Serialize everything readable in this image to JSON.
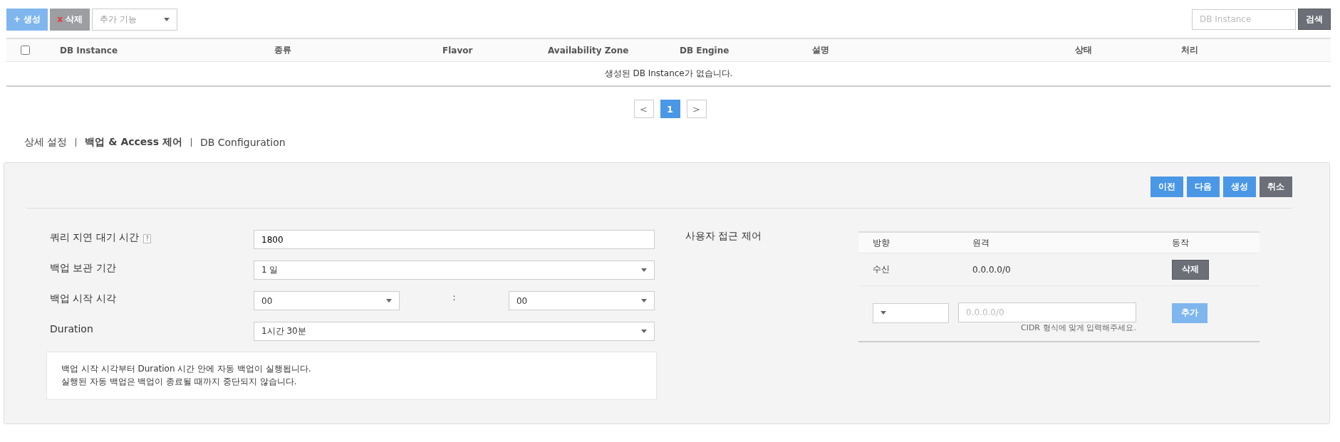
{
  "toolbar": {
    "create_button": "+ 생성",
    "delete_button": {
      "mark": "x",
      "label": "삭제"
    },
    "more_dropdown": {
      "placeholder": "추가 기능"
    },
    "search": {
      "placeholder": "DB Instance",
      "button": "검색"
    }
  },
  "table": {
    "select_all": {
      "checked": false
    },
    "columns": [
      "DB Instance",
      "종류",
      "Flavor",
      "Availability Zone",
      "DB Engine",
      "설명",
      "상태",
      "처리"
    ],
    "empty_message": "생성된 DB Instance가 없습니다."
  },
  "pagination": {
    "prev": "<",
    "pages": [
      {
        "label": "1",
        "selected": true
      }
    ],
    "next": ">"
  },
  "tabs": [
    {
      "label": "상세 설정",
      "selected": false
    },
    {
      "label": "백업 & Access 제어",
      "selected": true
    },
    {
      "label": "DB Configuration",
      "selected": false
    }
  ],
  "actions": [
    {
      "label": "이전",
      "kind": "primary"
    },
    {
      "label": "다음",
      "kind": "primary"
    },
    {
      "label": "생성",
      "kind": "primary"
    },
    {
      "label": "취소",
      "kind": "secondary"
    }
  ],
  "form": {
    "query_timeout": {
      "label": "쿼리 지연 대기 시간",
      "help": "?",
      "value": "1800"
    },
    "backup_retention": {
      "label": "백업 보관 기간",
      "value": "1 일"
    },
    "backup_start": {
      "label": "백업 시작 시각",
      "hour": "00",
      "separator": ":",
      "minute": "00"
    },
    "duration": {
      "label": "Duration",
      "value": "1시간 30분"
    },
    "notice": [
      "백업 시작 시각부터 Duration 시간 안에 자동 백업이 실행됩니다.",
      "실행된 자동 백업은 백업이 종료될 때까지 중단되지 않습니다."
    ]
  },
  "access_control": {
    "label": "사용자 접근 제어",
    "columns": [
      "방향",
      "원격",
      "동작"
    ],
    "rules": [
      {
        "direction": "수신",
        "remote": "0.0.0.0/0",
        "action": "삭제"
      }
    ],
    "new_rule": {
      "remote_placeholder": "0.0.0.0/0",
      "hint": "CIDR 형식에 맞게 입력해주세요.",
      "add_button": "추가"
    }
  }
}
